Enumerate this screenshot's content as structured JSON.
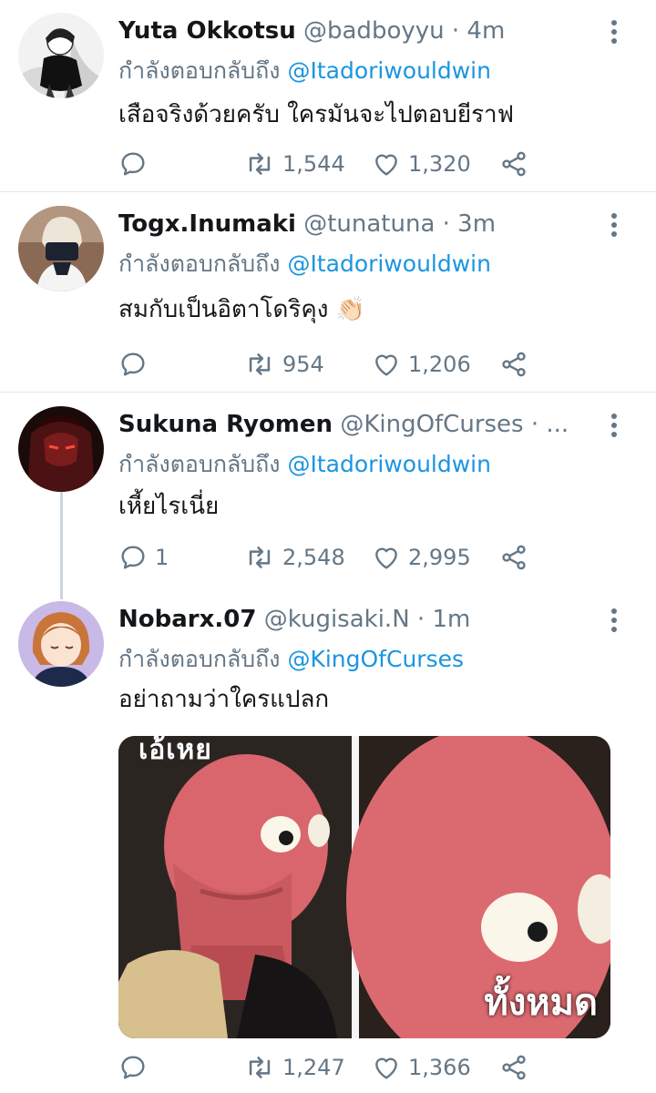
{
  "reply_prefix": "กำลังตอบกลับถึง",
  "colors": {
    "link": "#1b95e0",
    "muted": "#657786",
    "divider": "#e1e8ed"
  },
  "icons": {
    "reply": "reply-icon",
    "retweet": "retweet-icon",
    "like": "heart-icon",
    "share": "share-icon",
    "more": "more-vertical-icon"
  },
  "tweets": [
    {
      "name": "Yuta Okkotsu",
      "handle": "@badboyyu",
      "sep": "·",
      "time": "4m",
      "reply_to": "@Itadoriwouldwin",
      "text": "เสือจริงด้วยครับ ใครมันจะไปตอบยีราฟ",
      "replies": "",
      "retweets": "1,544",
      "likes": "1,320"
    },
    {
      "name": "Togx.Inumaki",
      "handle": "@tunatuna",
      "sep": "·",
      "time": "3m",
      "reply_to": "@Itadoriwouldwin",
      "text": "สมกับเป็นอิตาโดริคุง",
      "emoji": "👏🏻",
      "replies": "",
      "retweets": "954",
      "likes": "1,206"
    },
    {
      "name": "Sukuna Ryomen",
      "handle": "@KingOfCurses",
      "sep": "· ...",
      "time": "",
      "reply_to": "@Itadoriwouldwin",
      "text": "เหี้ยไรเนี่ย",
      "replies": "1",
      "retweets": "2,548",
      "likes": "2,995"
    },
    {
      "name": "Nobarx.07",
      "handle": "@kugisaki.N",
      "sep": "·",
      "time": "1m",
      "reply_to": "@KingOfCurses",
      "text": "อย่าถามว่าใครแปลก",
      "media_caption_left": "เอ้เหย",
      "media_caption_right": "ทั้งหมด",
      "replies": "",
      "retweets": "1,247",
      "likes": "1,366"
    }
  ]
}
